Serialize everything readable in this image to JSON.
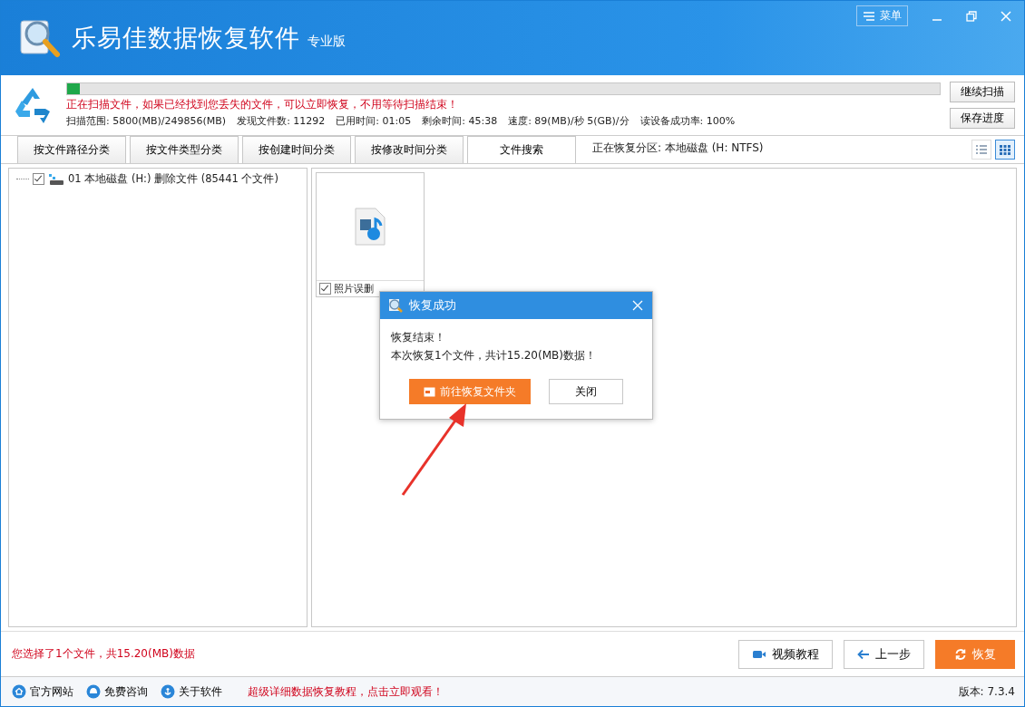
{
  "app": {
    "title": "乐易佳数据恢复软件",
    "edition": "专业版",
    "menu": "菜单"
  },
  "scan": {
    "level": 0.015,
    "notice": "正在扫描文件，如果已经找到您丢失的文件，可以立即恢复，不用等待扫描结束！",
    "stats": [
      "扫描范围: 5800(MB)/249856(MB)",
      "发现文件数: 11292",
      "已用时间: 01:05",
      "剩余时间: 45:38",
      "速度: 89(MB)/秒  5(GB)/分",
      "读设备成功率: 100%"
    ],
    "buttons": [
      "继续扫描",
      "保存进度"
    ]
  },
  "tabs": [
    {
      "label": "按文件路径分类",
      "selected": false
    },
    {
      "label": "按文件类型分类",
      "selected": false
    },
    {
      "label": "按创建时间分类",
      "selected": false
    },
    {
      "label": "按修改时间分类",
      "selected": false
    },
    {
      "label": "文件搜索",
      "selected": true
    }
  ],
  "partition": "正在恢复分区: 本地磁盘 (H: NTFS)",
  "views": [
    {
      "kind": "list",
      "selected": false
    },
    {
      "kind": "grid",
      "selected": true
    }
  ],
  "tree": [
    {
      "label": "01 本地磁盘 (H:) 删除文件  (85441 个文件)",
      "checked": true
    }
  ],
  "files": [
    {
      "name": "照片误删",
      "checked": true
    }
  ],
  "dialog": {
    "title": "恢复成功",
    "lines": [
      "恢复结束！",
      "本次恢复1个文件，共计15.20(MB)数据！"
    ],
    "primary": "前往恢复文件夹",
    "secondary": "关闭"
  },
  "summary": "您选择了1个文件，共15.20(MB)数据",
  "actions": [
    {
      "kind": "video",
      "label": "视频教程"
    },
    {
      "kind": "back",
      "label": "上一步"
    },
    {
      "kind": "recover",
      "label": "恢复"
    }
  ],
  "footer": {
    "links": [
      {
        "kind": "home",
        "label": "官方网站"
      },
      {
        "kind": "chat",
        "label": "免费咨询"
      },
      {
        "kind": "anchor",
        "label": "关于软件"
      }
    ],
    "promo": "超级详细数据恢复教程，点击立即观看！",
    "version": "版本: 7.3.4"
  }
}
